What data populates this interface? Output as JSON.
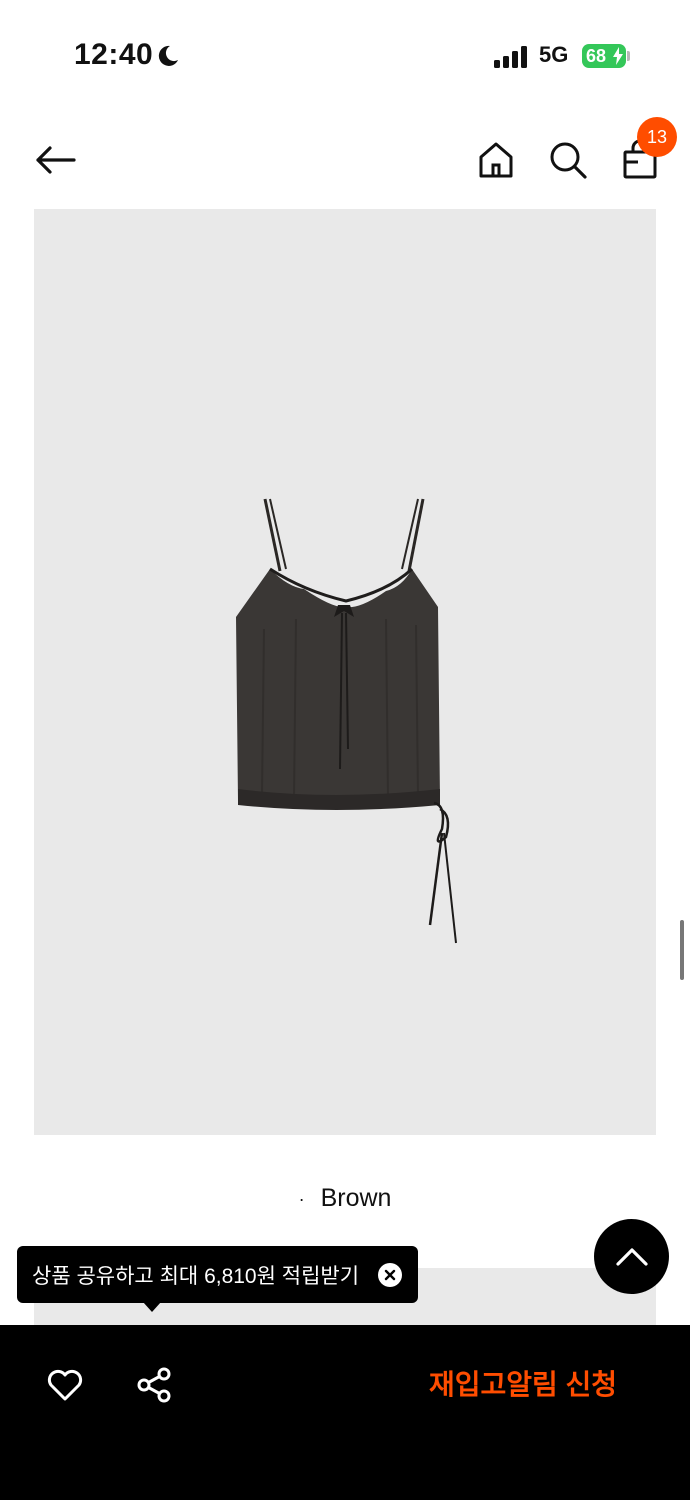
{
  "status_bar": {
    "time": "12:40",
    "network": "5G",
    "battery": "68"
  },
  "header": {
    "cart_count": "13"
  },
  "product": {
    "color_name": "Brown"
  },
  "tooltip": {
    "text": "상품 공유하고 최대 6,810원 적립받기"
  },
  "bottom_bar": {
    "restock_label": "재입고알림 신청"
  },
  "colors": {
    "accent": "#ff4d00",
    "battery": "#34c759",
    "image_bg": "#e9e9e9"
  }
}
